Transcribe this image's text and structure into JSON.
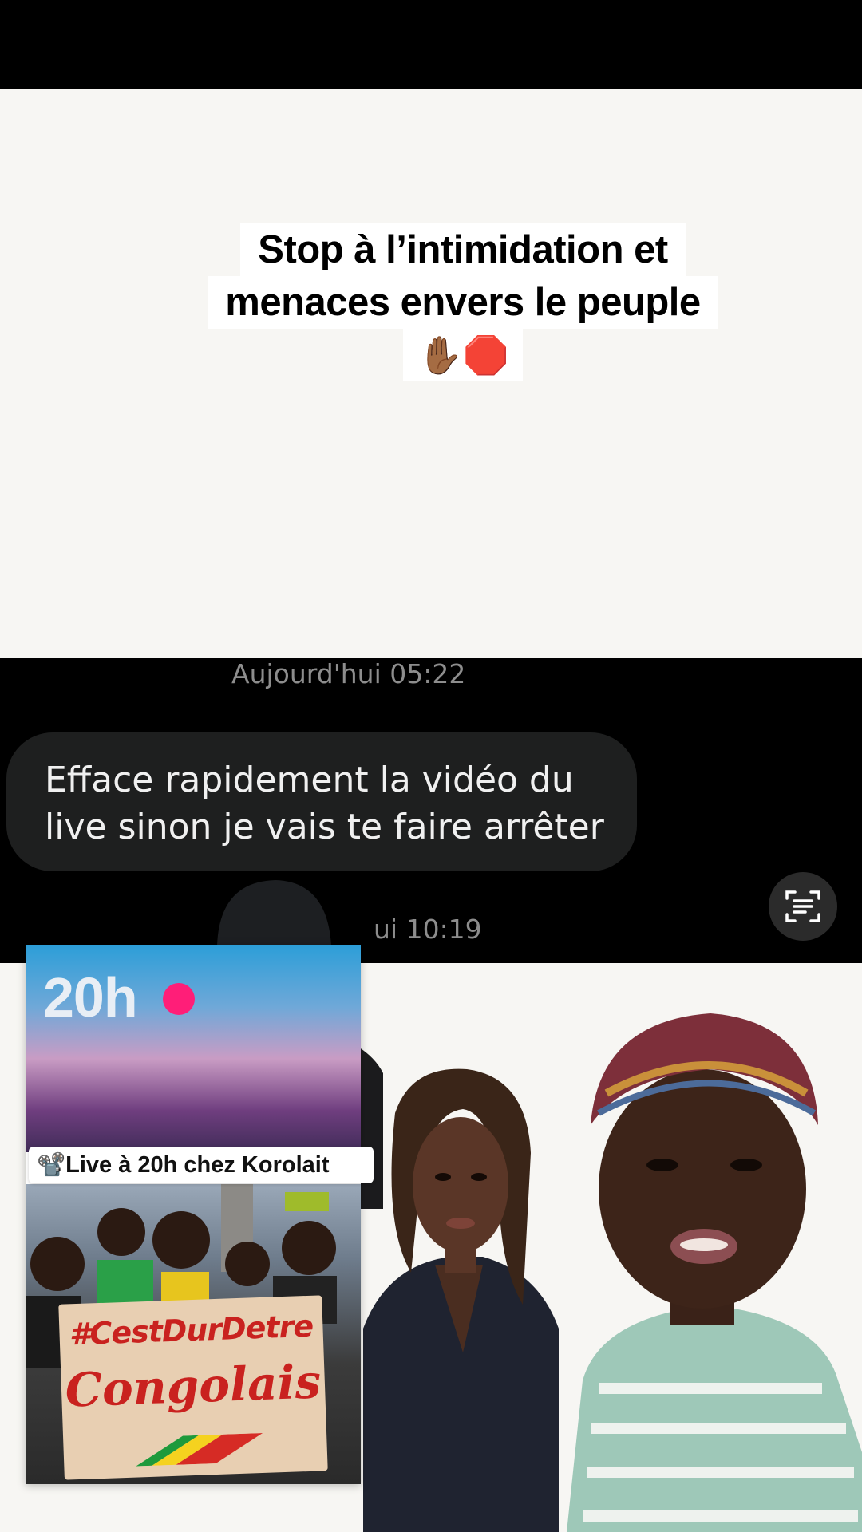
{
  "caption": {
    "line1": "Stop à l’intimidation et",
    "line2": "menaces envers le peuple",
    "emoji": "✋🏾🛑"
  },
  "chat": {
    "timestamp_top": "Aujourd'hui 05:22",
    "message": "Efface rapidement la vidéo du live sinon je vais te faire arrêter",
    "timestamp_bottom": "ui 10:19",
    "scan_icon": "text-scan-icon"
  },
  "thumbnail": {
    "top_label": "20h",
    "live_banner": "📽️Live à 20h chez Korolait",
    "sign_line1": "#CestDurDetre",
    "sign_line2": "Congolais"
  },
  "colors": {
    "background_light": "#f7f6f3",
    "bubble": "#1e1f1f",
    "sign_red": "#c9221f",
    "live_dot": "#ff1e78"
  }
}
